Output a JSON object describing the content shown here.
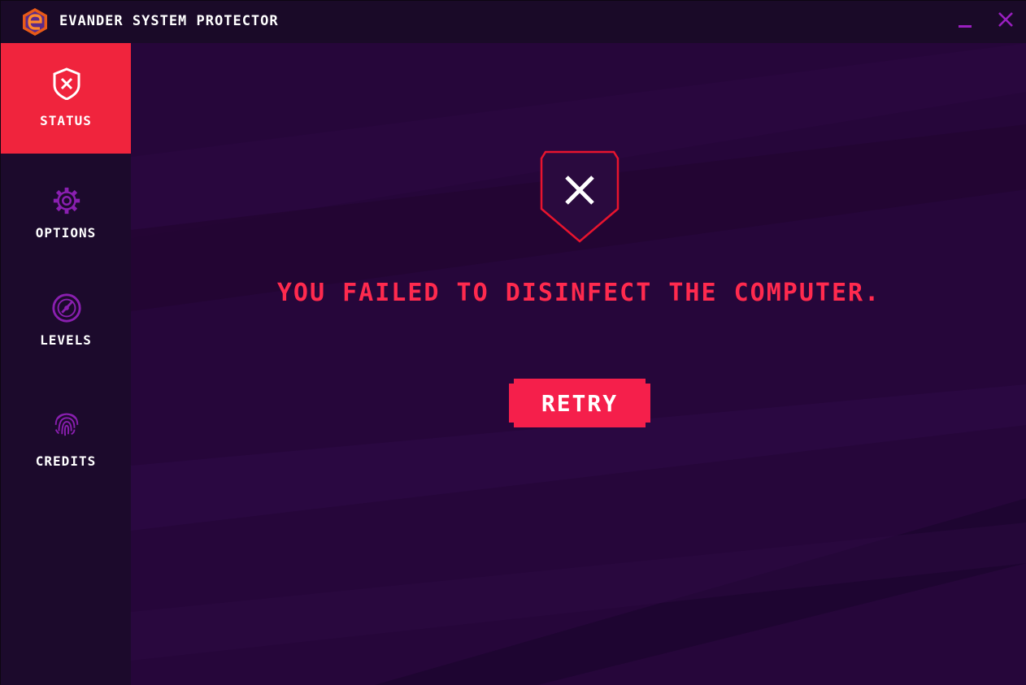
{
  "window": {
    "title": "EVANDER SYSTEM PROTECTOR",
    "logo_icon": "e-hexagon-logo",
    "minimize_icon": "minimize-icon",
    "close_icon": "close-icon"
  },
  "sidebar": {
    "items": [
      {
        "id": "status",
        "label": "STATUS",
        "icon": "shield-x-icon",
        "active": true
      },
      {
        "id": "options",
        "label": "OPTIONS",
        "icon": "gear-icon",
        "active": false
      },
      {
        "id": "levels",
        "label": "LEVELS",
        "icon": "gauge-icon",
        "active": false
      },
      {
        "id": "credits",
        "label": "CREDITS",
        "icon": "fingerprint-icon",
        "active": false
      }
    ]
  },
  "main": {
    "status_icon": "shield-x-icon",
    "message": "YOU FAILED TO DISINFECT THE COMPUTER.",
    "retry_label": "RETRY"
  },
  "colors": {
    "accent": "#f0243d",
    "message": "#ff2a4e",
    "icon_purple": "#8a1fb0",
    "background": "#26063a",
    "sidebar": "#1c0a2c",
    "titlebar": "#1a0a28"
  }
}
